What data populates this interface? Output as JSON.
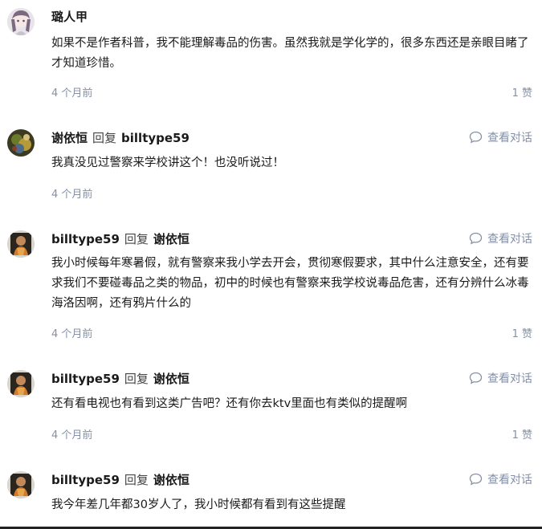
{
  "comments": [
    {
      "author": "璐人甲",
      "reply": null,
      "text": "如果不是作者科普，我不能理解毒品的伤害。虽然我就是学化学的，很多东西还是亲眼目睹了才知道珍惜。",
      "time": "4 个月前",
      "likes": "1 赞",
      "view_conversation": null
    },
    {
      "author": "谢依恒",
      "reply": {
        "word": "回复",
        "to": "billtype59"
      },
      "text": "我真没见过警察来学校讲这个！也没听说过！",
      "time": "4 个月前",
      "likes": null,
      "view_conversation": "查看对话"
    },
    {
      "author": "billtype59",
      "reply": {
        "word": "回复",
        "to": "谢依恒"
      },
      "text": "我小时候每年寒暑假，就有警察来我小学去开会，贯彻寒假要求，其中什么注意安全，还有要求我们不要碰毒品之类的物品，初中的时候也有警察来我学校说毒品危害，还有分辨什么冰毒海洛因啊，还有鸦片什么的",
      "time": "4 个月前",
      "likes": "1 赞",
      "view_conversation": "查看对话"
    },
    {
      "author": "billtype59",
      "reply": {
        "word": "回复",
        "to": "谢依恒"
      },
      "text": "还有看电视也有看到这类广告吧？还有你去ktv里面也有类似的提醒啊",
      "time": "4 个月前",
      "likes": "1 赞",
      "view_conversation": "查看对话"
    },
    {
      "author": "billtype59",
      "reply": {
        "word": "回复",
        "to": "谢依恒"
      },
      "text": "我今年差几年都30岁人了，我小时候都有看到有这些提醒",
      "time": null,
      "likes": null,
      "view_conversation": "查看对话"
    }
  ],
  "icons": {
    "conversation": "chat-bubble-icon"
  },
  "colors": {
    "meta": "#8590a6",
    "text": "#1a1a1a"
  }
}
